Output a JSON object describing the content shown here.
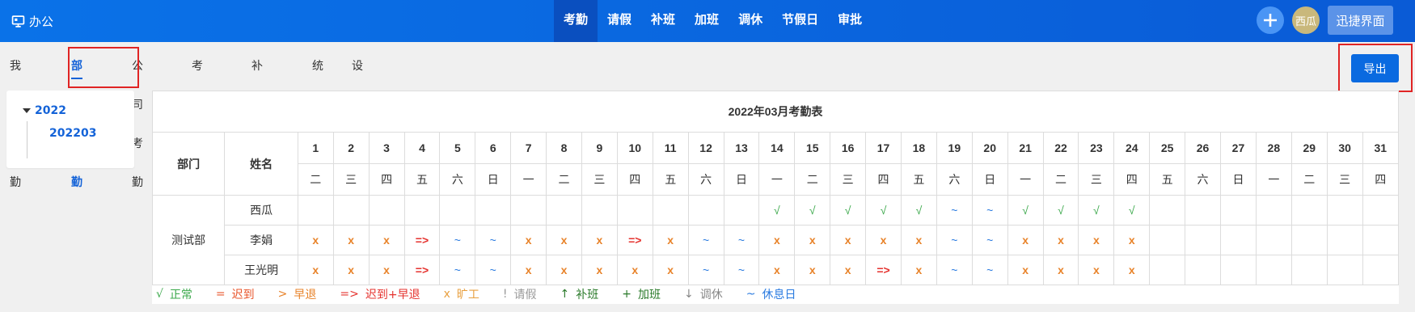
{
  "topbar": {
    "logo": "办公",
    "nav": [
      {
        "label": "考勤",
        "active": true
      },
      {
        "label": "请假",
        "active": false
      },
      {
        "label": "补班",
        "active": false
      },
      {
        "label": "加班",
        "active": false
      },
      {
        "label": "调休",
        "active": false
      },
      {
        "label": "节假日",
        "active": false
      },
      {
        "label": "审批",
        "active": false
      }
    ],
    "avatar": "西瓜",
    "quick_label": "迅捷界面"
  },
  "subtabs": [
    {
      "label": "我的考勤",
      "active": false
    },
    {
      "label": "部门考勤",
      "active": true
    },
    {
      "label": "公司考勤",
      "active": false
    },
    {
      "label": "考勤明细",
      "active": false
    },
    {
      "label": "补录审核",
      "active": false
    },
    {
      "label": "统计",
      "active": false
    },
    {
      "label": "设置",
      "active": false
    }
  ],
  "export_label": "导出",
  "tree": {
    "year": "2022",
    "month": "202203"
  },
  "sheet": {
    "title": "2022年03月考勤表",
    "dept_header": "部门",
    "name_header": "姓名",
    "days": [
      "1",
      "2",
      "3",
      "4",
      "5",
      "6",
      "7",
      "8",
      "9",
      "10",
      "11",
      "12",
      "13",
      "14",
      "15",
      "16",
      "17",
      "18",
      "19",
      "20",
      "21",
      "22",
      "23",
      "24",
      "25",
      "26",
      "27",
      "28",
      "29",
      "30",
      "31"
    ],
    "weekdays": [
      "二",
      "三",
      "四",
      "五",
      "六",
      "日",
      "一",
      "二",
      "三",
      "四",
      "五",
      "六",
      "日",
      "一",
      "二",
      "三",
      "四",
      "五",
      "六",
      "日",
      "一",
      "二",
      "三",
      "四",
      "五",
      "六",
      "日",
      "一",
      "二",
      "三",
      "四"
    ],
    "department": "测试部",
    "employees": [
      {
        "name": "西瓜",
        "marks": [
          "",
          "",
          "",
          "",
          "",
          "",
          "",
          "",
          "",
          "",
          "",
          "",
          "",
          "√",
          "√",
          "√",
          "√",
          "√",
          "~",
          "~",
          "√",
          "√",
          "√",
          "√",
          "",
          "",
          "",
          "",
          "",
          "",
          ""
        ]
      },
      {
        "name": "李娟",
        "marks": [
          "x",
          "x",
          "x",
          "=>",
          "~",
          "~",
          "x",
          "x",
          "x",
          "=>",
          "x",
          "~",
          "~",
          "x",
          "x",
          "x",
          "x",
          "x",
          "~",
          "~",
          "x",
          "x",
          "x",
          "x",
          "",
          "",
          "",
          "",
          "",
          "",
          ""
        ]
      },
      {
        "name": "王光明",
        "marks": [
          "x",
          "x",
          "x",
          "=>",
          "~",
          "~",
          "x",
          "x",
          "x",
          "x",
          "x",
          "~",
          "~",
          "x",
          "x",
          "x",
          "=>",
          "x",
          "~",
          "~",
          "x",
          "x",
          "x",
          "x",
          "",
          "",
          "",
          "",
          "",
          "",
          ""
        ]
      }
    ]
  },
  "legend": [
    {
      "symbol": "√",
      "label": "正常",
      "color": "#3aa84a"
    },
    {
      "symbol": "=",
      "label": "迟到",
      "color": "#e8542a"
    },
    {
      "symbol": ">",
      "label": "早退",
      "color": "#e8832a"
    },
    {
      "symbol": "=>",
      "label": "迟到+早退",
      "color": "#e5322e"
    },
    {
      "symbol": "x",
      "label": "旷工",
      "color": "#e8a040"
    },
    {
      "symbol": "!",
      "label": "请假",
      "color": "#999999"
    },
    {
      "symbol": "↑",
      "label": "补班",
      "color": "#2a7a2a"
    },
    {
      "symbol": "+",
      "label": "加班",
      "color": "#2a7a2a"
    },
    {
      "symbol": "↓",
      "label": "调休",
      "color": "#888888"
    },
    {
      "symbol": "~",
      "label": "休息日",
      "color": "#2a7be0"
    }
  ]
}
